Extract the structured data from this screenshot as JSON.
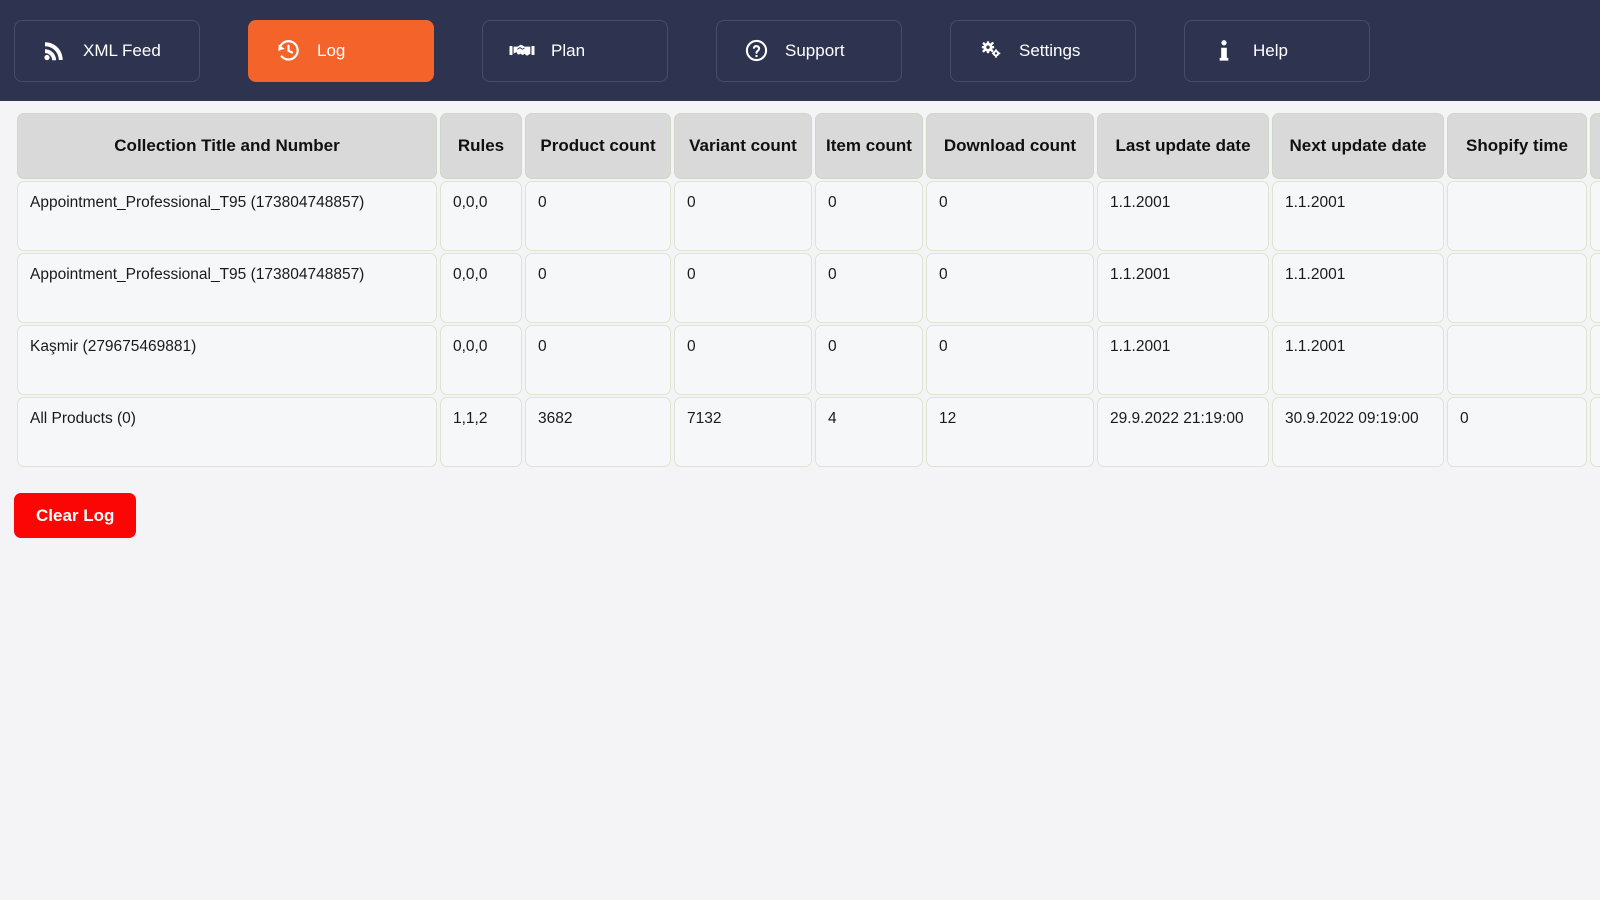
{
  "nav": {
    "items": [
      {
        "label": "XML Feed",
        "icon": "rss-icon",
        "name": "nav-xml-feed",
        "active": false
      },
      {
        "label": "Log",
        "icon": "history-icon",
        "name": "nav-log",
        "active": true
      },
      {
        "label": "Plan",
        "icon": "handshake-icon",
        "name": "nav-plan",
        "active": false
      },
      {
        "label": "Support",
        "icon": "question-circle-icon",
        "name": "nav-support",
        "active": false
      },
      {
        "label": "Settings",
        "icon": "cogs-icon",
        "name": "nav-settings",
        "active": false
      },
      {
        "label": "Help",
        "icon": "info-icon",
        "name": "nav-help",
        "active": false
      }
    ],
    "active_color": "#f4642a",
    "background_color": "#2e3450"
  },
  "table": {
    "headers": [
      "Collection Title and Number",
      "Rules",
      "Product count",
      "Variant count",
      "Item count",
      "Download count",
      "Last update date",
      "Next update date",
      "Shopify time",
      ""
    ],
    "rows": [
      {
        "title": "Appointment_Professional_T95 (173804748857)",
        "rules": "0,0,0",
        "product_count": "0",
        "variant_count": "0",
        "item_count": "0",
        "download_count": "0",
        "last_update_date": "1.1.2001",
        "next_update_date": "1.1.2001",
        "shopify_time": "",
        "extra": ""
      },
      {
        "title": "Appointment_Professional_T95 (173804748857)",
        "rules": "0,0,0",
        "product_count": "0",
        "variant_count": "0",
        "item_count": "0",
        "download_count": "0",
        "last_update_date": "1.1.2001",
        "next_update_date": "1.1.2001",
        "shopify_time": "",
        "extra": ""
      },
      {
        "title": "Kaşmir (279675469881)",
        "rules": "0,0,0",
        "product_count": "0",
        "variant_count": "0",
        "item_count": "0",
        "download_count": "0",
        "last_update_date": "1.1.2001",
        "next_update_date": "1.1.2001",
        "shopify_time": "",
        "extra": ""
      },
      {
        "title": "All Products (0)",
        "rules": "1,1,2",
        "product_count": "3682",
        "variant_count": "7132",
        "item_count": "4",
        "download_count": "12",
        "last_update_date": "29.9.2022 21:19:00",
        "next_update_date": "30.9.2022 09:19:00",
        "shopify_time": "0",
        "extra": ""
      }
    ]
  },
  "actions": {
    "clear_log_label": "Clear Log",
    "clear_log_color": "#fb0505"
  }
}
